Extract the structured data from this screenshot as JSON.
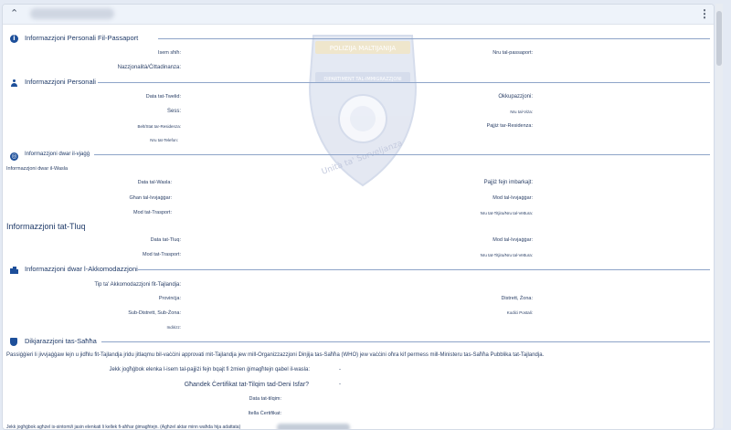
{
  "header": {
    "expand_icon": "chevron-up-icon",
    "menu_icon": "kebab-menu-icon"
  },
  "watermark": {
    "top_text": "POLIZIJA MALTIJANIJA",
    "mid_text": "DIPARTIMENT TAL-IMMIGRAZZJONI",
    "bottom_text": "Unità ta' Sorveljanza"
  },
  "passport": {
    "title": "Informazzjoni Personali Fil-Passaport",
    "icon": "info-icon",
    "name_label": "Isem sħiħ:",
    "passport_no_label": "Nru tal-passaport:",
    "nationality_label": "Nazzjonalità/Ċittadinanza:"
  },
  "personal": {
    "title": "Informazzjoni Personali",
    "icon": "person-icon",
    "dob_label": "Data tat-Twelid:",
    "occupation_label": "Okkupazzjoni:",
    "sex_label": "Sess:",
    "visa_no_label": "Nru tal-Viża:",
    "residence_city_label": "Belt/Stat tar-Residenza:",
    "residence_country_label": "Pajjiż tar-Residenza:",
    "phone_label": "Nru tat-Telefon:"
  },
  "travel": {
    "title": "Informazzjoni dwar il-vjaġġ",
    "icon": "globe-icon",
    "arrival_subtitle": "Informazzjoni dwar il-Wasla",
    "arrival_date_label": "Data tal-Wasla:",
    "embark_country_label": "Pajjiż fejn imbarkajt:",
    "travel_purpose_label": "Għan tal-Ivvjaġġar:",
    "travel_mode_label": "Mod tal-Ivvjaġġar:",
    "transport_mode_label": "Mod tat-Trasport:",
    "flight_no_label": "Nru tat-Titjira/Nru tal-Vettura:"
  },
  "departure": {
    "title": "Informazzjoni tat-Tluq",
    "departure_date_label": "Data tat-Tluq:",
    "travel_mode_label": "Mod tal-Ivvjaġġar:",
    "transport_mode_label": "Mod tat-Trasport:",
    "flight_no_label": "Nru tat-Titjira/Nru tal-Vettura:"
  },
  "accommodation": {
    "title": "Informazzjoni dwar l-Akkomodazzjoni",
    "icon": "building-icon",
    "type_label": "Tip ta' Akkomodazzjoni fit-Tajlandja:",
    "province_label": "Provinċja:",
    "district_label": "Distrett, Żona:",
    "subdistrict_label": "Sub-Distrett, Sub-Żona:",
    "postcode_label": "Kodiċi Postali:",
    "address_label": "Indirizz:"
  },
  "health": {
    "title": "Dikjarazzjoni tas-Saħħa",
    "icon": "shield-icon",
    "notice": "Passiġġieri li jivvjaġġaw lejn u jidħlu fit-Tajlandja jridu jitlaqmu bil-vaċċini approvati mit-Tajlandja jew mill-Organizzazzjoni Dinjija tas-Saħħa (WHO) jew vaċċini oħra kif permess mill-Ministeru tas-Saħħa Pubblika tat-Tajlandja.",
    "visited_question": "Jekk jogħġbok elenka l-isem tal-pajjiżi fejn bqajt fi żmien ġimagħtejn qabel il-wasla:",
    "visited_value": "-",
    "yellow_fever_question": "Għandek Ċertifikat tat-Tilqim tad-Deni Isfar?",
    "yellow_fever_value": "-",
    "vaccination_date_label": "Data tat-tilqim:",
    "certificate_label": "Itella Ċertifikat:",
    "footer_text": "Jekk jogħġbok agħżel is-sintomi/i jasin elenkati li kellek fi-aħħar ġimagħtejn. (Agħżel aktar minn waħda hija adattata)"
  }
}
